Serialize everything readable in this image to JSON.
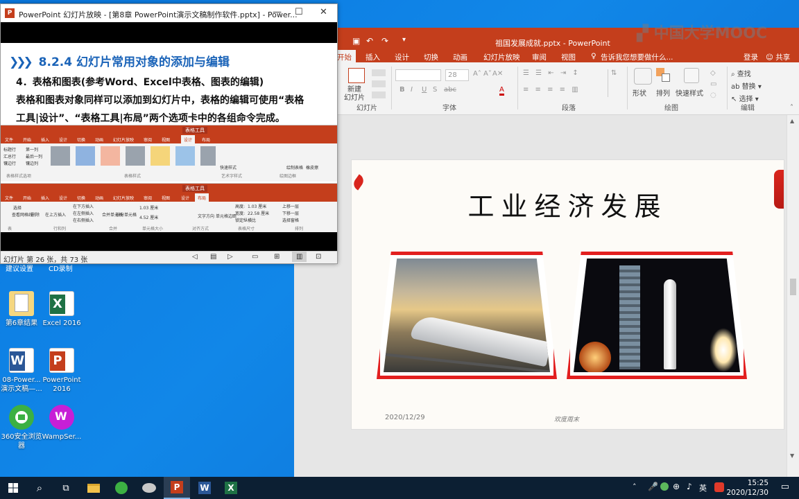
{
  "desktop": {
    "icons": [
      {
        "label": "第6章结果",
        "kind": "folder-doc"
      },
      {
        "label": "Excel 2016",
        "kind": "excel"
      },
      {
        "label": "08-Power...\n演示文稿—...",
        "kind": "word"
      },
      {
        "label": "PowerPoint\n2016",
        "kind": "powerpoint"
      },
      {
        "label": "360安全浏览\n器",
        "kind": "browser"
      },
      {
        "label": "WampSer...",
        "kind": "wamp"
      }
    ],
    "partial_labels": [
      "建议设置",
      "CD录制"
    ]
  },
  "watermark": "中国大学MOOC",
  "slideshow_window": {
    "title": "PowerPoint 幻灯片放映 - [第8章 PowerPoint演示文稿制作软件.pptx] - Power...",
    "heading": "8.2.4  幻灯片常用对象的添加与编辑",
    "line1": "4．表格和图表(参考Word、Excel中表格、图表的编辑)",
    "line2": "表格和图表对象同样可以添加到幻灯片中，表格的编辑可使用“表格",
    "line3": "工具|设计”、“表格工具|布局”两个选项卡中的各组命令完成。",
    "status": "幻灯片 第 26 张，共 73 张",
    "mini_ribbon_1": {
      "tab_label": "表格工具",
      "tabs": [
        "文件",
        "开始",
        "插入",
        "设计",
        "切换",
        "动画",
        "幻灯片放映",
        "审阅",
        "视图",
        "设计",
        "布局"
      ],
      "groups": [
        "表格样式选项",
        "表格样式",
        "艺术字样式",
        "绘图边框"
      ],
      "checks": [
        "标题行",
        "第一列",
        "汇总行",
        "最后一列",
        "镶边行",
        "镶边列"
      ],
      "actions": [
        "快速样式",
        "绘制表格",
        "橡皮擦"
      ]
    },
    "mini_ribbon_2": {
      "tab_label": "表格工具",
      "groups": [
        "表",
        "行和列",
        "合并",
        "单元格大小",
        "对齐方式",
        "表格尺寸",
        "排列"
      ],
      "buttons": [
        "选择",
        "查看网格线",
        "删除",
        "在上方插入",
        "在下方插入",
        "在左侧插入",
        "在右侧插入",
        "合并单元格",
        "拆分单元格",
        "文字方向",
        "单元格边距"
      ],
      "values": [
        "1.03 厘米",
        "4.52 厘米",
        "1.03 厘米",
        "22.58 厘米"
      ],
      "labels": [
        "高度:",
        "宽度:",
        "锁定纵横比",
        "上移一层",
        "下移一层",
        "选择窗格"
      ]
    }
  },
  "editor": {
    "title": "祖国发展成就.pptx - PowerPoint",
    "tabs": [
      "开始",
      "插入",
      "设计",
      "切换",
      "动画",
      "幻灯片放映",
      "审阅",
      "视图"
    ],
    "active_tab": "开始",
    "tell_me": "告诉我您想要做什么...",
    "login": "登录",
    "share": "共享",
    "groups": [
      "幻灯片",
      "字体",
      "段落",
      "绘图",
      "编辑"
    ],
    "new_slide": "新建\n幻灯片",
    "font_size": "28",
    "font_buttons": [
      "B",
      "I",
      "U",
      "S",
      "abc",
      "A"
    ],
    "drawing_buttons": [
      "形状",
      "排列",
      "快速样式"
    ],
    "editing_buttons": [
      "查找",
      "替换",
      "选择"
    ],
    "slide": {
      "title": "工业经济发展",
      "date": "2020/12/29",
      "footer": "欢度周末"
    }
  },
  "taskbar": {
    "time": "15:25",
    "date": "2020/12/30",
    "ime": "英",
    "apps": [
      "start",
      "search",
      "task-view",
      "file-explorer",
      "browser-360",
      "network-app",
      "powerpoint",
      "word",
      "excel"
    ],
    "active_app": "powerpoint"
  },
  "colors": {
    "ppt_red": "#c43e1c",
    "frame_red": "#e21f1f",
    "heading_blue": "#1a63b8",
    "taskbar": "#0c1f33"
  }
}
